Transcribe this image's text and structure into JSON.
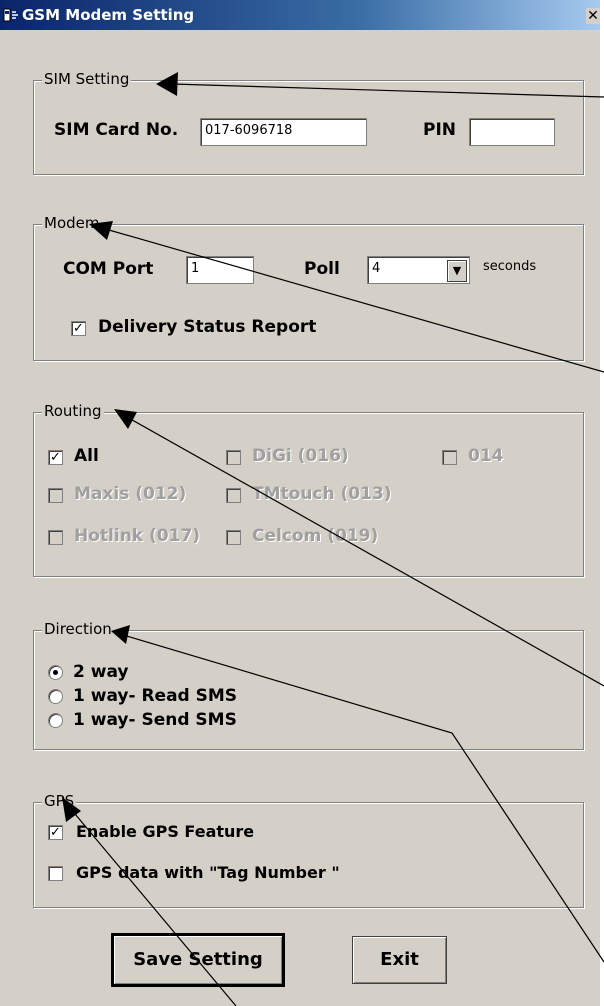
{
  "window": {
    "title": "GSM Modem Setting",
    "close_glyph": "✕"
  },
  "sim": {
    "legend": "SIM Setting",
    "card_label": "SIM Card No.",
    "card_value": "017-6096718",
    "pin_label": "PIN",
    "pin_value": ""
  },
  "modem": {
    "legend": "Modem",
    "com_label": "COM Port",
    "com_value": "1",
    "poll_label": "Poll",
    "poll_value": "4",
    "seconds_label": "seconds",
    "delivery_label": "Delivery Status Report",
    "delivery_checked": true
  },
  "routing": {
    "legend": "Routing",
    "items": [
      {
        "label": "All",
        "checked": true,
        "enabled": true
      },
      {
        "label": "DiGi (016)",
        "checked": false,
        "enabled": false
      },
      {
        "label": "014",
        "checked": false,
        "enabled": false
      },
      {
        "label": "Maxis (012)",
        "checked": false,
        "enabled": false
      },
      {
        "label": "TMtouch (013)",
        "checked": false,
        "enabled": false
      },
      {
        "label": "Hotlink (017)",
        "checked": false,
        "enabled": false
      },
      {
        "label": "Celcom (019)",
        "checked": false,
        "enabled": false
      }
    ]
  },
  "direction": {
    "legend": "Direction",
    "options": [
      {
        "label": "2 way",
        "selected": true
      },
      {
        "label": "1 way- Read SMS",
        "selected": false
      },
      {
        "label": "1 way- Send SMS",
        "selected": false
      }
    ]
  },
  "gps": {
    "legend": "GPS",
    "enable_label": "Enable GPS Feature",
    "enable_checked": true,
    "tag_label": "GPS data with \"Tag Number \"",
    "tag_checked": false
  },
  "buttons": {
    "save_label": "Save Setting",
    "exit_label": "Exit"
  },
  "colors": {
    "title_bar_start": "#0a246a",
    "title_bar_end": "#a6caf0",
    "window_face": "#d4d0c8",
    "disabled_text": "#a0a0a0"
  },
  "check_glyph": "✓",
  "dropdown_glyph": "▼"
}
